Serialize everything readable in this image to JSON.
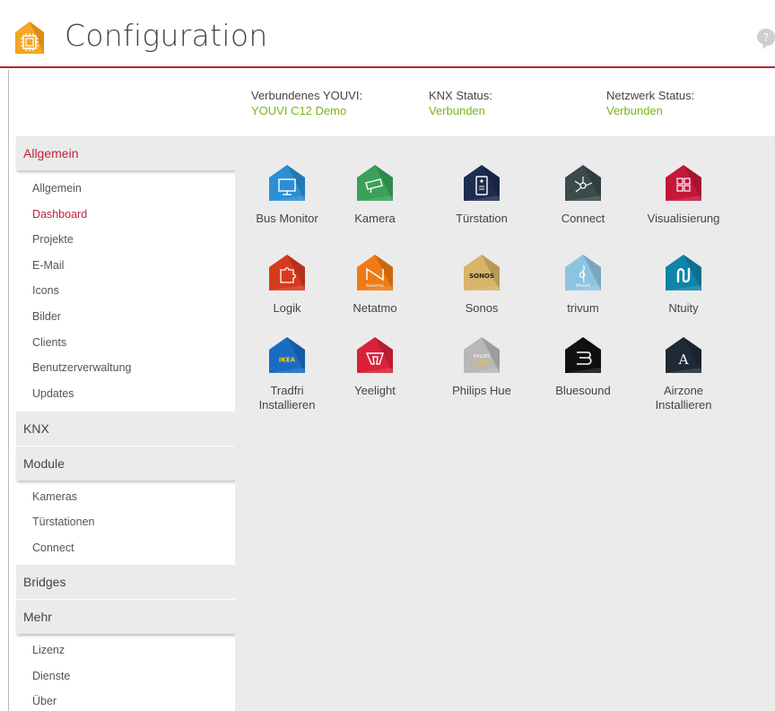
{
  "header": {
    "title": "Configuration"
  },
  "status": {
    "youvi_label": "Verbundenes YOUVI:",
    "youvi_value": "YOUVI C12 Demo",
    "knx_label": "KNX Status:",
    "knx_value": "Verbunden",
    "network_label": "Netzwerk Status:",
    "network_value": "Verbunden"
  },
  "sidebar": {
    "allgemein": {
      "title": "Allgemein",
      "items": [
        "Allgemein",
        "Dashboard",
        "Projekte",
        "E-Mail",
        "Icons",
        "Bilder",
        "Clients",
        "Benutzerverwaltung",
        "Updates"
      ]
    },
    "knx": {
      "title": "KNX"
    },
    "module": {
      "title": "Module",
      "items": [
        "Kameras",
        "Türstationen",
        "Connect"
      ]
    },
    "bridges": {
      "title": "Bridges"
    },
    "mehr": {
      "title": "Mehr",
      "items": [
        "Lizenz",
        "Dienste",
        "Über"
      ]
    }
  },
  "tiles": [
    {
      "label": "Bus Monitor",
      "color": "#2a8fd4",
      "icon": "monitor-icon"
    },
    {
      "label": "Kamera",
      "color": "#3aa05a",
      "icon": "camera-icon"
    },
    {
      "label": "Türstation",
      "color": "#1d2d4f",
      "icon": "door-station-icon"
    },
    {
      "label": "Connect",
      "color": "#3b4a4a",
      "icon": "connect-icon"
    },
    {
      "label": "Visualisierung",
      "color": "#c4173a",
      "icon": "grid-icon"
    },
    {
      "label": "Logik",
      "color": "#d63a1e",
      "icon": "puzzle-icon"
    },
    {
      "label": "Netatmo",
      "color": "#f07a14",
      "icon": "netatmo-icon",
      "sub": "Netatmo"
    },
    {
      "label": "Sonos",
      "color": "#d7b46a",
      "icon": "sonos-icon",
      "sub": "SONOS"
    },
    {
      "label": "trivum",
      "color": "#8ec3e0",
      "icon": "trivum-icon",
      "sub": "trivum"
    },
    {
      "label": "Ntuity",
      "color": "#0e84a8",
      "icon": "ntuity-icon"
    },
    {
      "label": "Tradfri\nInstallieren",
      "color": "#1a6cc2",
      "icon": "ikea-icon",
      "sub": "IKEA"
    },
    {
      "label": "Yeelight",
      "color": "#d9213a",
      "icon": "yeelight-icon"
    },
    {
      "label": "Philips Hue",
      "color": "#b8b8b8",
      "icon": "hue-icon",
      "sub": "PHILIPS",
      "sub2": "hue"
    },
    {
      "label": "Bluesound",
      "color": "#111111",
      "icon": "bluesound-icon"
    },
    {
      "label": "Airzone\nInstallieren",
      "color": "#1f2a36",
      "icon": "airzone-icon",
      "sub": "A"
    }
  ]
}
